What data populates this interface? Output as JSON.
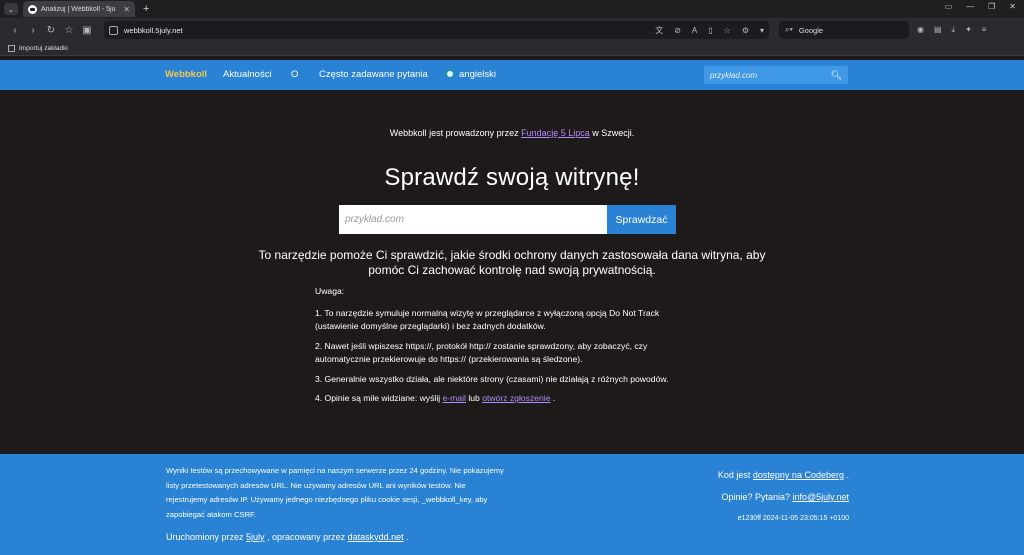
{
  "browser": {
    "tab_title": "Analizuj | Webbkoll - 5ju",
    "url": "webbkoll.5july.net",
    "search_engine": "Google",
    "bookmarks_item": "Importuj zakładki"
  },
  "nav": {
    "brand": "Webbkoll",
    "items": [
      "Aktualności",
      "O",
      "Często zadawane pytania"
    ],
    "language": "angielski",
    "search_placeholder": "przykład.com"
  },
  "main": {
    "intro_prefix": "Webbkoll jest prowadzony przez ",
    "intro_link": "Fundację 5 Lipca",
    "intro_suffix": " w Szwecji.",
    "heading": "Sprawdź swoją witrynę!",
    "input_placeholder": "przykład.com",
    "submit_label": "Sprawdzać",
    "description": "To narzędzie pomoże Ci sprawdzić, jakie środki ochrony danych zastosowała dana witryna, aby pomóc Ci zachować kontrolę nad swoją prywatnością.",
    "notes_label": "Uwaga:",
    "notes": [
      "1. To narzędzie symuluje normalną wizytę w przeglądarce z wyłączoną opcją Do Not Track (ustawienie domyślne przeglądarki) i bez żadnych dodatków.",
      "2. Nawet jeśli wpiszesz https://, protokół http:// zostanie sprawdzony, aby zobaczyć, czy automatycznie przekierowuje do https:// (przekierowania są śledzone).",
      "3. Generalnie wszystko działa, ale niektóre strony (czasami) nie działają z różnych powodów."
    ],
    "note4_prefix": "4. Opinie są mile widziane: wyślij ",
    "note4_email": "e-mail",
    "note4_mid": " lub ",
    "note4_issue": "otwórz zgłoszenie",
    "note4_suffix": " ."
  },
  "footer": {
    "storage_text": "Wyniki testów są przechowywane w pamięci na naszym serwerze przez 24 godziny. Nie pokazujemy listy przetestowanych adresów URL. Nie używamy adresów URL ani wyników testów. Nie rejestrujemy adresów IP. Używamy jednego niezbędnego pliku cookie sesji, _webbkoll_key, aby zapobiegać atakom CSRF.",
    "run_prefix": "Uruchomiony przez ",
    "run_5july": "5july",
    "run_mid": " , opracowany przez ",
    "run_dataskydd": "dataskydd.net",
    "run_suffix": " .",
    "code_prefix": "Kod jest ",
    "code_link": "dostępny na Codeberg",
    "code_suffix": " .",
    "contact_prefix": "Opinie? Pytania? ",
    "contact_email": "info@5july.net",
    "version": "e1230ff 2024-11-05 23:05:15 +0100"
  }
}
